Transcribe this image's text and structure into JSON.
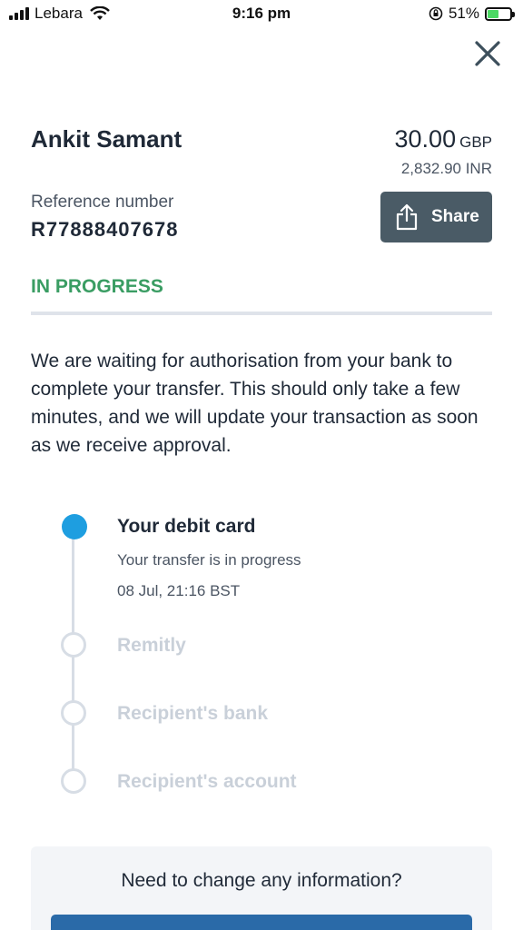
{
  "status_bar": {
    "carrier": "Lebara",
    "time": "9:16 pm",
    "battery": "51%"
  },
  "transfer": {
    "recipient_name": "Ankit Samant",
    "amount": "30.00",
    "currency": "GBP",
    "converted_amount": "2,832.90 INR",
    "reference_label": "Reference number",
    "reference_number": "R77888407678",
    "share_label": "Share",
    "status": "IN PROGRESS",
    "message": "We are waiting for authorisation from your bank to complete your transfer. This should only take a few minutes, and we will update your transaction as soon as we receive approval."
  },
  "timeline": [
    {
      "title": "Your debit card",
      "subtitle": "Your transfer is in progress",
      "timestamp": "08 Jul, 21:16 BST",
      "state": "active"
    },
    {
      "title": "Remitly",
      "state": "pending"
    },
    {
      "title": "Recipient's bank",
      "state": "pending"
    },
    {
      "title": "Recipient's account",
      "state": "pending"
    }
  ],
  "help": {
    "question": "Need to change any information?"
  },
  "colors": {
    "status_green": "#3a9d63",
    "active_step": "#1e9ee0",
    "share_button": "#4a5b66",
    "primary_button": "#2a6aa8"
  },
  "icons": {
    "close": "close-icon",
    "share": "share-icon"
  }
}
